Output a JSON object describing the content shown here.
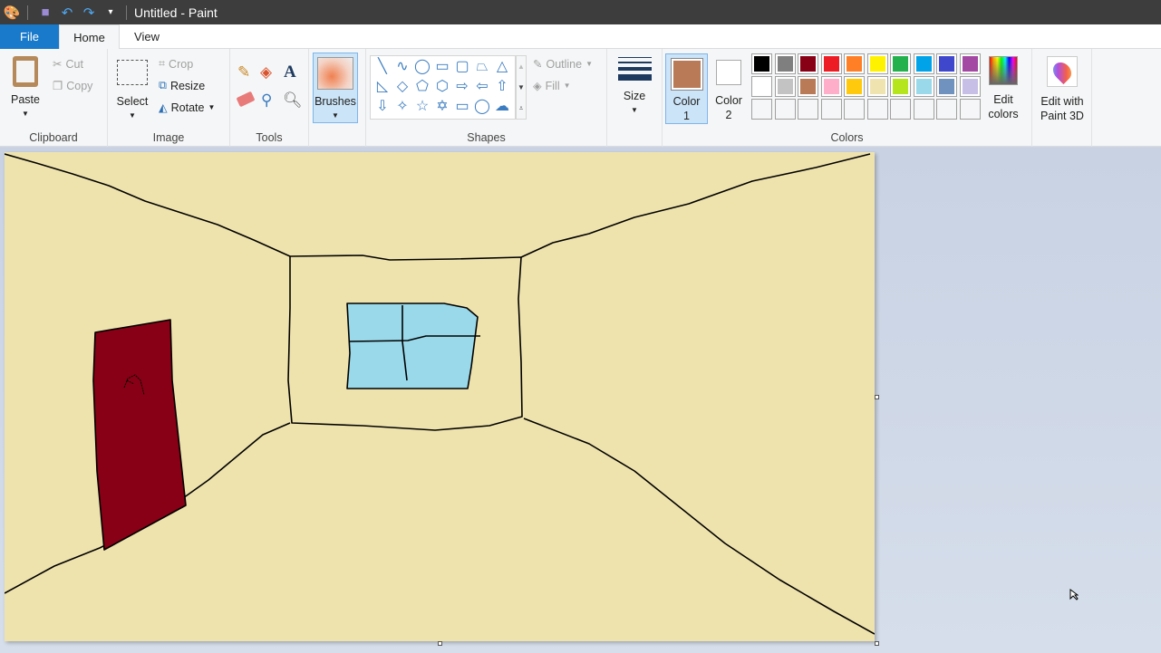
{
  "titlebar": {
    "title": "Untitled - Paint"
  },
  "tabs": {
    "file": "File",
    "home": "Home",
    "view": "View"
  },
  "clipboard": {
    "paste": "Paste",
    "cut": "Cut",
    "copy": "Copy",
    "label": "Clipboard"
  },
  "image": {
    "select": "Select",
    "crop": "Crop",
    "resize": "Resize",
    "rotate": "Rotate",
    "label": "Image"
  },
  "tools": {
    "label": "Tools"
  },
  "brushes": {
    "label": "Brushes"
  },
  "shapes": {
    "label": "Shapes",
    "outline": "Outline",
    "fill": "Fill",
    "items": [
      "line",
      "curve",
      "oval",
      "rectangle",
      "rounded-rectangle",
      "polygon",
      "triangle",
      "right-triangle",
      "diamond",
      "pentagon",
      "hexagon",
      "right-arrow",
      "left-arrow",
      "up-arrow",
      "down-arrow",
      "four-point-star",
      "five-point-star",
      "six-point-star",
      "rounded-callout",
      "oval-callout",
      "cloud-callout"
    ]
  },
  "size": {
    "label": "Size"
  },
  "color1": {
    "label1": "Color",
    "label2": "1",
    "value": "#b97a57"
  },
  "color2": {
    "label1": "Color",
    "label2": "2",
    "value": "#ffffff"
  },
  "colors": {
    "label": "Colors",
    "edit1": "Edit",
    "edit2": "colors",
    "row1": [
      "#000000",
      "#7f7f7f",
      "#880015",
      "#ed1c24",
      "#ff7f27",
      "#fff200",
      "#22b14c",
      "#00a2e8",
      "#3f48cc",
      "#a349a4"
    ],
    "row2": [
      "#ffffff",
      "#c3c3c3",
      "#b97a57",
      "#ffaec9",
      "#ffc90e",
      "#efe4b0",
      "#b5e61d",
      "#99d9ea",
      "#7092be",
      "#c8bfe7"
    ]
  },
  "paint3d": {
    "line1": "Edit with",
    "line2": "Paint 3D"
  },
  "drawing": {
    "background": "#efe3ad",
    "door": "#880015",
    "window": "#99d9ea"
  }
}
